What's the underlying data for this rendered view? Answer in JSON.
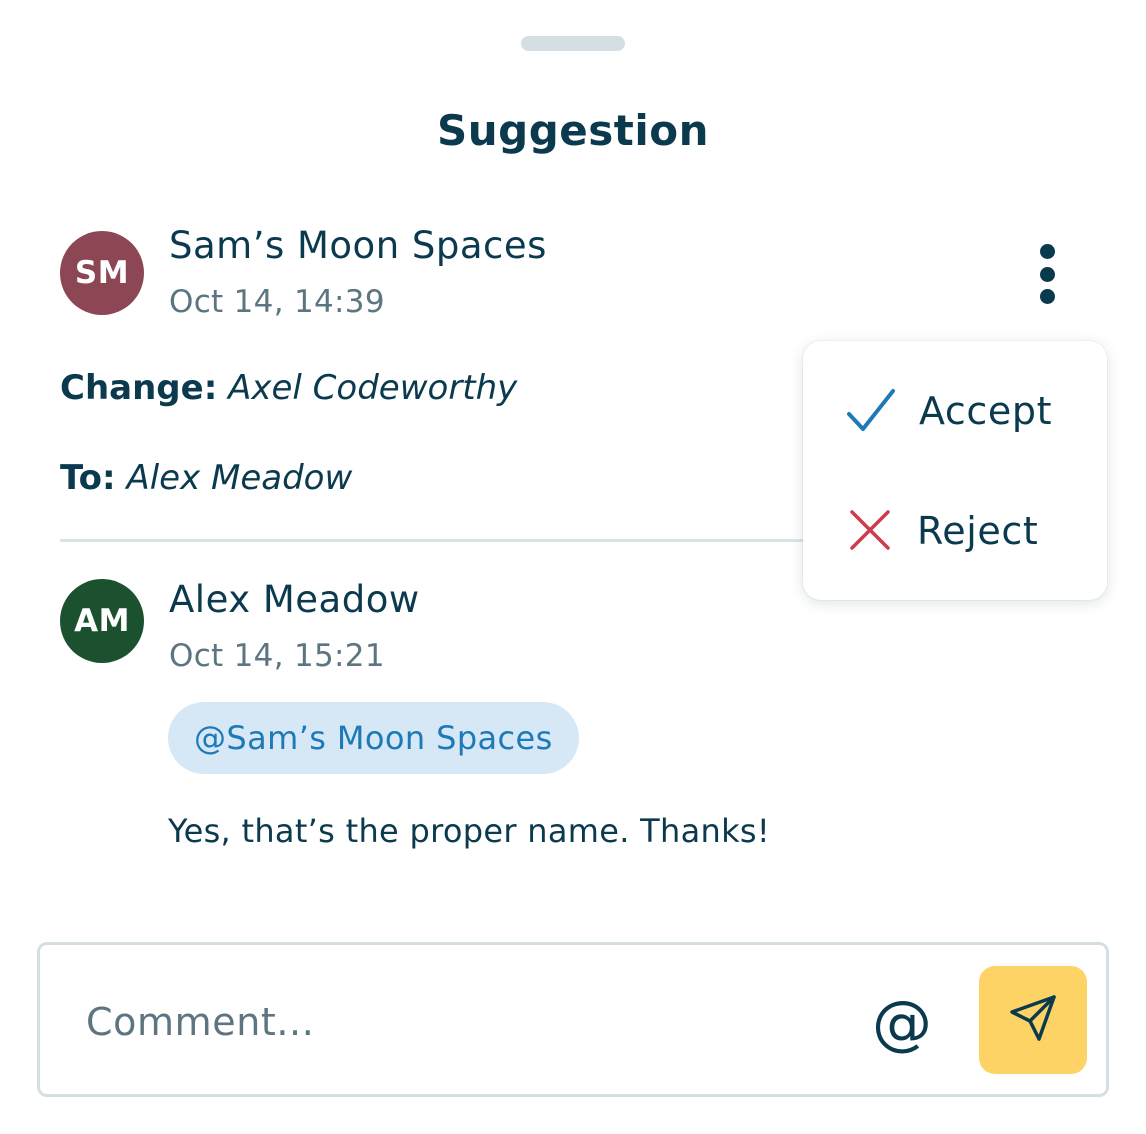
{
  "sheet": {
    "title": "Suggestion"
  },
  "suggestion": {
    "author_initials": "SM",
    "author_name": "Sam’s Moon Spaces",
    "timestamp": "Oct 14, 14:39",
    "avatar_color": "#8c4654",
    "change_label": "Change:",
    "change_value": "Axel Codeworthy",
    "to_label": "To:",
    "to_value": "Alex Meadow",
    "more_icon": "more-vertical-icon"
  },
  "menu": {
    "accept_label": "Accept",
    "accept_icon": "checkmark-icon",
    "accept_color": "#1e79b7",
    "reject_label": "Reject",
    "reject_icon": "x-icon",
    "reject_color": "#d03b4b"
  },
  "reply": {
    "author_initials": "AM",
    "author_name": "Alex Meadow",
    "timestamp": "Oct 14, 15:21",
    "avatar_color": "#1c5130",
    "mention": "@Sam’s Moon Spaces",
    "message": "Yes, that’s the proper name. Thanks!"
  },
  "composer": {
    "placeholder": "Comment...",
    "value": "",
    "mention_symbol": "@",
    "send_icon": "send-icon",
    "send_color": "#fdd365"
  }
}
